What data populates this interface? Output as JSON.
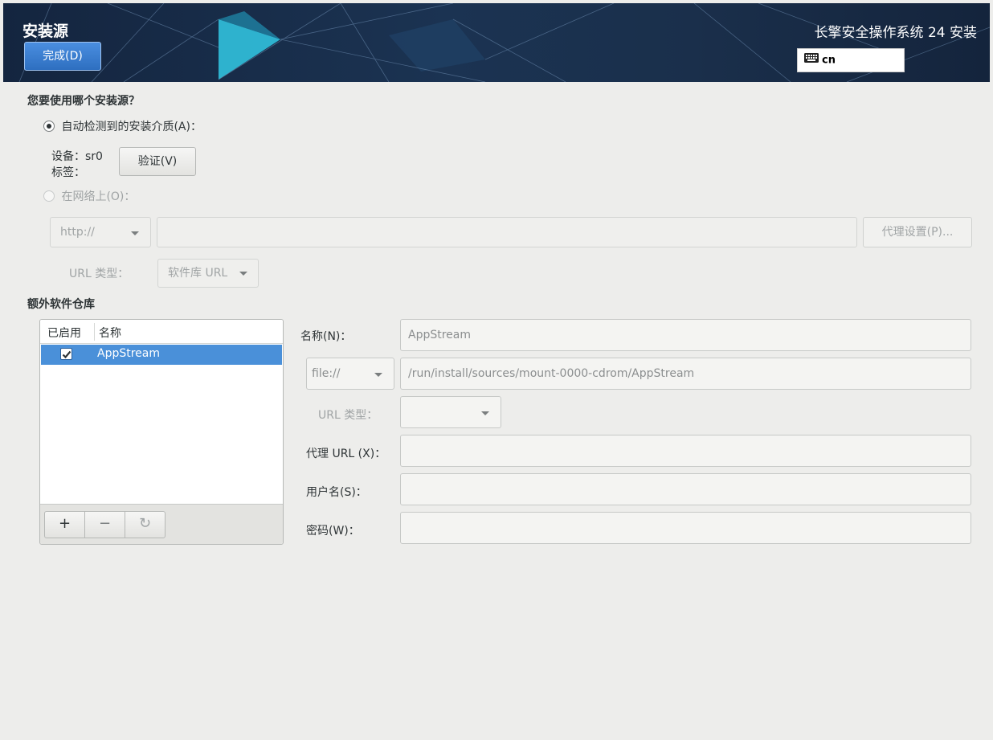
{
  "header": {
    "spoke_title": "安装源",
    "done_label": "完成(D)",
    "product_title": "长擎安全操作系统 24 安装",
    "keyboard_layout": "cn"
  },
  "source": {
    "question": "您要使用哪个安装源？",
    "auto_option_label": "自动检测到的安装介质(A)：",
    "device_label": "设备：sr0",
    "tag_label": "标签：",
    "verify_label": "验证(V)",
    "network_option_label": "在网络上(O)：",
    "protocol_value": "http://",
    "url_value": "",
    "proxy_label": "代理设置(P)...",
    "url_type_label": "URL 类型：",
    "url_type_value": "软件库 URL"
  },
  "repos": {
    "title": "额外软件仓库",
    "col_enabled": "已启用",
    "col_name": "名称",
    "items": [
      {
        "enabled": true,
        "name": "AppStream"
      }
    ],
    "add_label": "+",
    "remove_label": "−",
    "reset_label": "↻"
  },
  "repo_detail": {
    "name_label": "名称(N)：",
    "name_value": "AppStream",
    "protocol_value": "file://",
    "url_value": "/run/install/sources/mount-0000-cdrom/AppStream",
    "url_type_label": "URL 类型：",
    "url_type_value": "",
    "proxy_url_label": "代理 URL (X)：",
    "proxy_url_value": "",
    "username_label": "用户名(S)：",
    "username_value": "",
    "password_label": "密码(W)：",
    "password_value": ""
  },
  "colors": {
    "accent": "#4a90d9",
    "header_bg": "#1b3352",
    "done_button": "#3b7fd0"
  },
  "icons": {
    "keyboard": "keyboard-icon",
    "checkbox_check": "checkmark-icon",
    "refresh": "refresh-icon"
  }
}
